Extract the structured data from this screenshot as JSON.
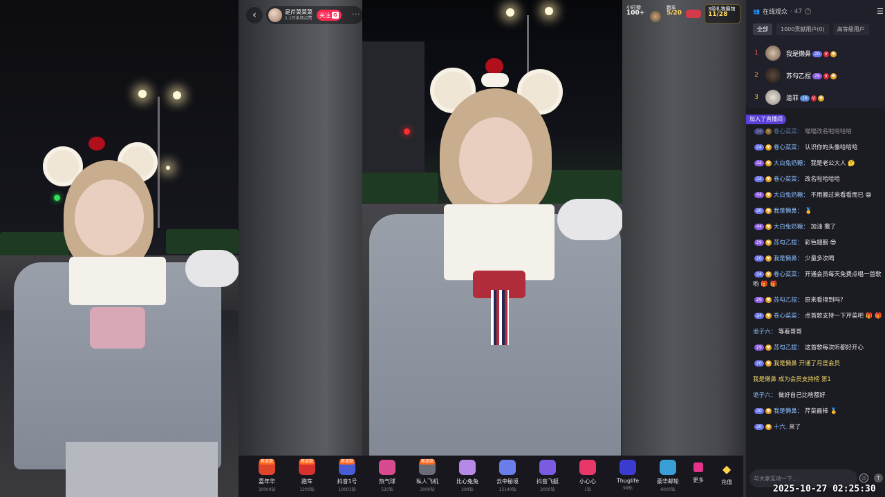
{
  "host": {
    "name": "是芹菜菜菜",
    "subtitle": "1.1万本场点赞",
    "follow_label": "关注",
    "follow_badge": "G"
  },
  "icons": {
    "back": "‹",
    "more": "···",
    "menu": "☰",
    "users": "👥",
    "smile": "☺",
    "send": "↑",
    "diamond": "◆"
  },
  "stats": {
    "hourly": {
      "label": "小时榜",
      "value": "100+"
    },
    "car": {
      "label": "跑车",
      "value": "5/20"
    },
    "gift_wall": {
      "label": "3级礼物展馆",
      "value": "11/28"
    }
  },
  "gifts": [
    {
      "name": "嘉年华",
      "price": "30000钻",
      "badge": "新皮肤",
      "icon": "🎪",
      "color": "#e0452c"
    },
    {
      "name": "跑车",
      "price": "1200钻",
      "badge": "新皮肤",
      "icon": "🏎",
      "color": "#d6322f"
    },
    {
      "name": "抖音1号",
      "price": "10001钻",
      "badge": "新皮肤",
      "icon": "🚀",
      "color": "#4a5bd6"
    },
    {
      "name": "热气球",
      "price": "520钻",
      "badge": "",
      "icon": "🎈",
      "color": "#d84a8e"
    },
    {
      "name": "私人飞机",
      "price": "3000钻",
      "badge": "新皮肤",
      "icon": "✈",
      "color": "#6c6c78"
    },
    {
      "name": "比心兔兔",
      "price": "299钻",
      "badge": "",
      "icon": "🐰",
      "color": "#b58ae6"
    },
    {
      "name": "云中秘境",
      "price": "13140钻",
      "badge": "",
      "icon": "🏯",
      "color": "#6a7de8"
    },
    {
      "name": "抖音飞艇",
      "price": "2000钻",
      "badge": "",
      "icon": "🛸",
      "color": "#7b5ce0"
    },
    {
      "name": "小心心",
      "price": "1钻",
      "badge": "",
      "icon": "❤",
      "color": "#e8386a"
    },
    {
      "name": "Thuglife",
      "price": "99钻",
      "badge": "",
      "icon": "🕶",
      "color": "#3b3bd0"
    },
    {
      "name": "豪华邮轮",
      "price": "6000钻",
      "badge": "",
      "icon": "🚢",
      "color": "#3a9fd6"
    }
  ],
  "gift_more_label": "更多",
  "recharge_label": "充值",
  "panel": {
    "title": "在线观众",
    "count": "· 47",
    "tabs": [
      "全部",
      "1000贡献用户(0)",
      "高等级用户"
    ],
    "ranks": [
      {
        "rank": "1",
        "name": "我是懒鼻",
        "level": "20",
        "rank_color": "#ff5a5a"
      },
      {
        "rank": "2",
        "name": "苏勾乙捏",
        "level": "29",
        "rank_color": "#ff9a3c"
      },
      {
        "rank": "3",
        "name": "逵菲",
        "level": "16",
        "rank_color": "#ffcc33"
      }
    ],
    "join_tip": "加入了直播间"
  },
  "chat": [
    {
      "level": "24",
      "user": "卷心菜菜：",
      "text": "喵喵改名啦哈哈哈",
      "faded": true
    },
    {
      "level": "24",
      "user": "卷心菜菜：",
      "text": "认识你的头像哈哈哈",
      "faded": false
    },
    {
      "level": "44",
      "user": "大白兔奶糖：",
      "text": "我是老公大人 🤔",
      "faded": false
    },
    {
      "level": "24",
      "user": "卷心菜菜：",
      "text": "改名啦哈哈哈",
      "faded": false
    },
    {
      "level": "44",
      "user": "大白兔奶糖：",
      "text": "不用搬过来看看而已 😁",
      "faded": false
    },
    {
      "level": "20",
      "user": "我是懒鼻：",
      "text": "🥇",
      "faded": false
    },
    {
      "level": "44",
      "user": "大白兔奶糖：",
      "text": "加油 撒了",
      "faded": false
    },
    {
      "level": "29",
      "user": "苏勾乙捏：",
      "text": "彩色翅膀 😎",
      "faded": false
    },
    {
      "level": "20",
      "user": "我是懒鼻：",
      "text": "少量多次喝",
      "faded": false
    },
    {
      "level": "24",
      "user": "卷心菜菜：",
      "text": "开通会员每天免费点唱一首歌哟 🎁 🎁",
      "faded": false
    },
    {
      "level": "29",
      "user": "苏勾乙捏：",
      "text": "原来看得到吗?",
      "faded": false
    },
    {
      "level": "24",
      "user": "卷心菜菜：",
      "text": "点首歌支持一下芹菜吧 🎁 🎁",
      "faded": false
    },
    {
      "level": "",
      "user": "诡子六：",
      "text": "等着哥哥",
      "faded": false
    },
    {
      "level": "29",
      "user": "苏勾乙捏：",
      "text": "这首歌每次听都好开心",
      "faded": false
    },
    {
      "level": "20",
      "user": "我是懒鼻",
      "text": "开通了月度会员",
      "faded": false,
      "system": true
    },
    {
      "level": "",
      "user": "我是懒鼻",
      "text": "成为会员支持榜 第1",
      "faded": false,
      "system": true
    },
    {
      "level": "",
      "user": "诡子六：",
      "text": "做好自己比啥都好",
      "faded": false
    },
    {
      "level": "20",
      "user": "我是懒鼻：",
      "text": "芹菜最棒 🥇",
      "faded": false
    },
    {
      "level": "20",
      "user": "十六.",
      "text": "来了",
      "faded": false
    }
  ],
  "input_placeholder": "与大家互动一下...",
  "timestamp": "2025-10-27 02:25:30"
}
